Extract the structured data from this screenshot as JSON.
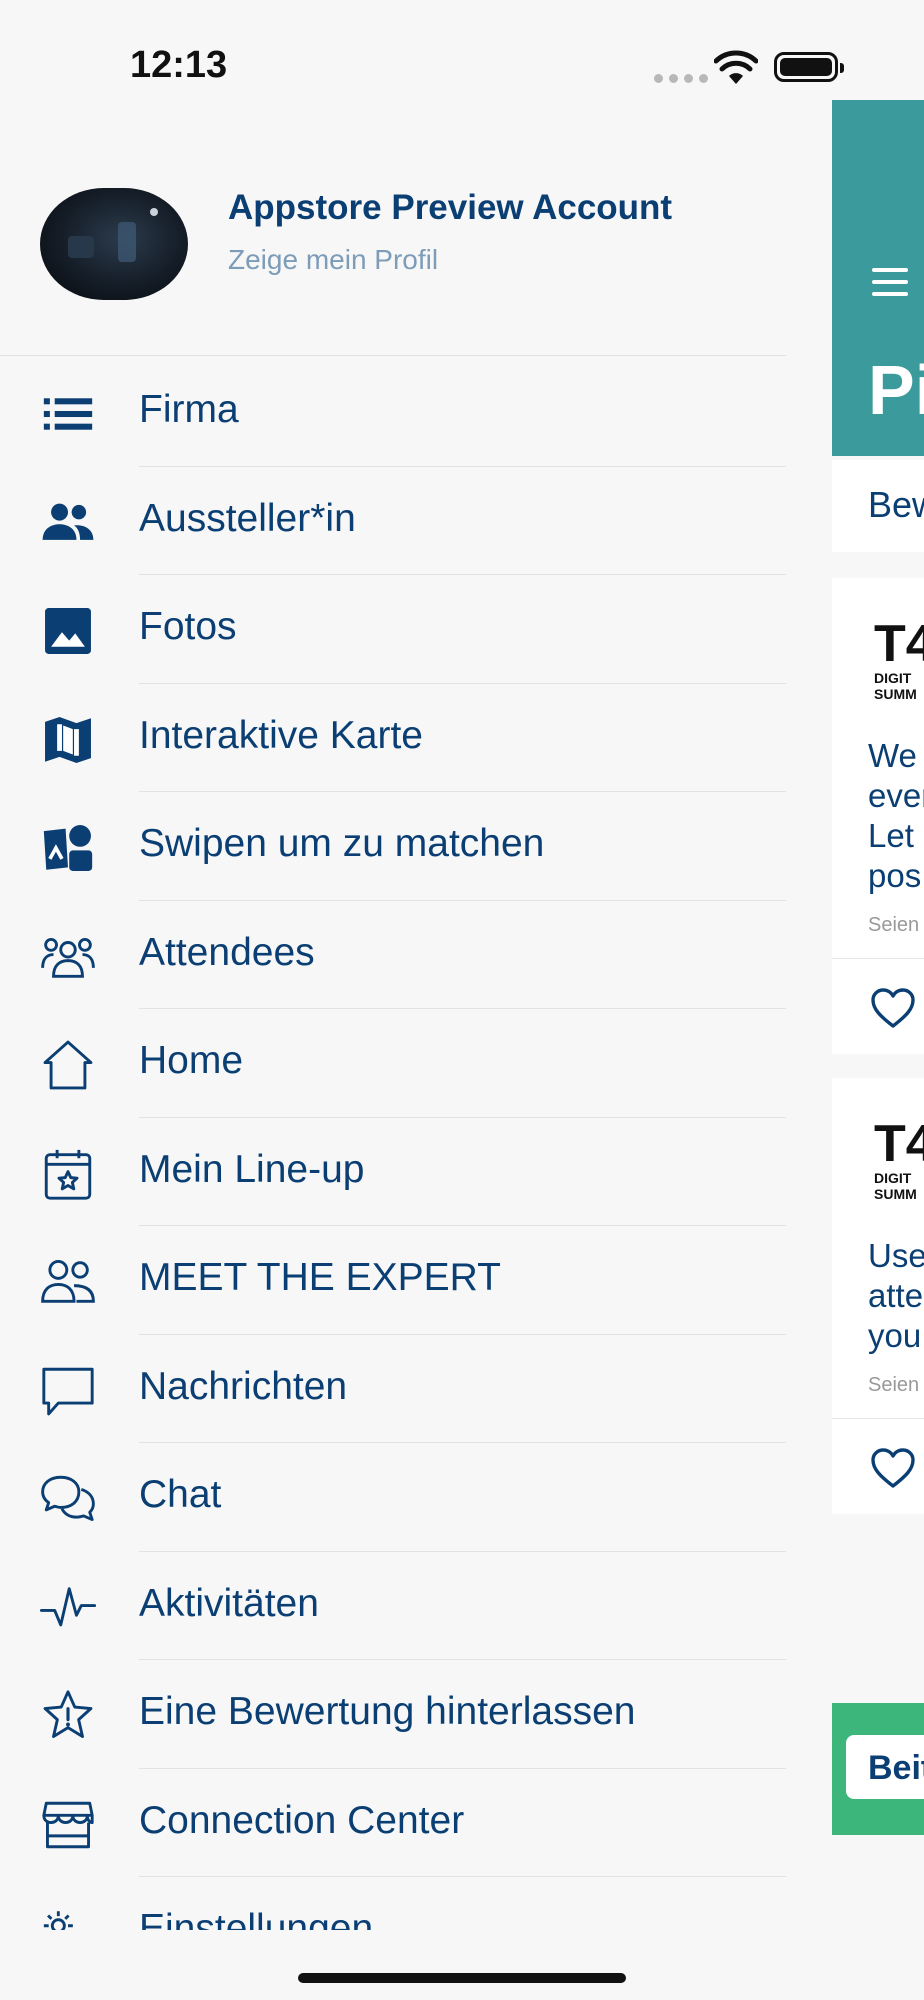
{
  "status_bar": {
    "time": "12:13"
  },
  "profile": {
    "name": "Appstore Preview Account",
    "subtitle": "Zeige mein Profil"
  },
  "menu": {
    "items": [
      {
        "label": "Firma",
        "icon": "list-icon"
      },
      {
        "label": "Aussteller*in",
        "icon": "people-icon"
      },
      {
        "label": "Fotos",
        "icon": "image-icon"
      },
      {
        "label": "Interaktive Karte",
        "icon": "map-icon"
      },
      {
        "label": "Swipen um zu matchen",
        "icon": "match-icon"
      },
      {
        "label": "Attendees",
        "icon": "attendees-icon"
      },
      {
        "label": "Home",
        "icon": "home-icon"
      },
      {
        "label": "Mein Line-up",
        "icon": "calendar-star-icon"
      },
      {
        "label": "MEET THE EXPERT",
        "icon": "experts-icon"
      },
      {
        "label": "Nachrichten",
        "icon": "message-icon"
      },
      {
        "label": "Chat",
        "icon": "chat-icon"
      },
      {
        "label": "Aktivitäten",
        "icon": "activity-icon"
      },
      {
        "label": "Eine Bewertung hinterlassen",
        "icon": "star-alert-icon"
      },
      {
        "label": "Connection Center",
        "icon": "store-icon"
      },
      {
        "label": "Einstellungen",
        "icon": "settings-icon"
      }
    ]
  },
  "main": {
    "title_fragment": "Pi",
    "tab_fragment": "Bew",
    "posts": [
      {
        "logo_mark": "T4",
        "logo_line1": "DIGIT",
        "logo_line2": "SUMM",
        "lines": [
          "We",
          "ever",
          "Let",
          "pos"
        ],
        "meta": "Seien"
      },
      {
        "logo_mark": "T4",
        "logo_line1": "DIGIT",
        "logo_line2": "SUMM",
        "lines": [
          "Use",
          "atte",
          "you"
        ],
        "meta": "Seien"
      }
    ],
    "button_fragment": "Beit"
  },
  "colors": {
    "primary_text": "#0b3f73",
    "header_teal": "#3b9a9c",
    "accent_green": "#3cb67a",
    "subtitle": "#7d9cb8"
  }
}
